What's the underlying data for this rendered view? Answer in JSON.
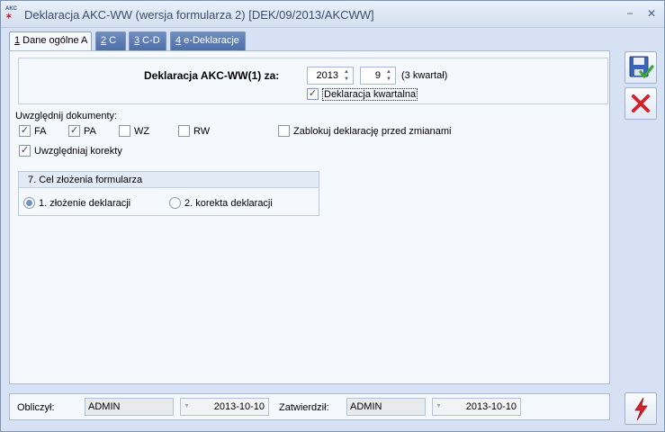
{
  "window": {
    "app_icon_top": "AKC",
    "app_icon_bottom": "✶",
    "title": "Deklaracja AKC-WW (wersja formularza 2) [DEK/09/2013/AKCWW]"
  },
  "tabs": [
    {
      "num": "1",
      "label": " Dane ogólne A"
    },
    {
      "num": "2",
      "label": " C"
    },
    {
      "num": "3",
      "label": " C-D"
    },
    {
      "num": "4",
      "label": " e-Deklaracje"
    }
  ],
  "header": {
    "label": "Deklaracja AKC-WW(1) za:",
    "year": "2013",
    "month": "9",
    "quarter_text": "(3 kwartał)",
    "quarterly_checkbox_label": "Deklaracja kwartalna",
    "quarterly_checked": true
  },
  "documents": {
    "label": "Uwzględnij dokumenty:",
    "items": [
      {
        "label": "FA",
        "checked": true
      },
      {
        "label": "PA",
        "checked": true
      },
      {
        "label": "WZ",
        "checked": false
      },
      {
        "label": "RW",
        "checked": false
      }
    ],
    "lock_label": "Zablokuj deklarację przed zmianami",
    "lock_checked": false,
    "corrections_label": "Uwzględniaj korekty",
    "corrections_checked": true
  },
  "purpose": {
    "title": "7. Cel złożenia formularza",
    "option1": "1. złożenie deklaracji",
    "option2": "2. korekta deklaracji",
    "selected": 1
  },
  "footer": {
    "calculated_label": "Obliczył:",
    "calculated_user": "ADMIN",
    "calculated_date": "2013-10-10",
    "approved_label": "Zatwierdził:",
    "approved_user": "ADMIN",
    "approved_date": "2013-10-10"
  },
  "icons": {
    "save": "save-icon",
    "cancel": "cancel-icon",
    "flash": "flash-icon"
  }
}
